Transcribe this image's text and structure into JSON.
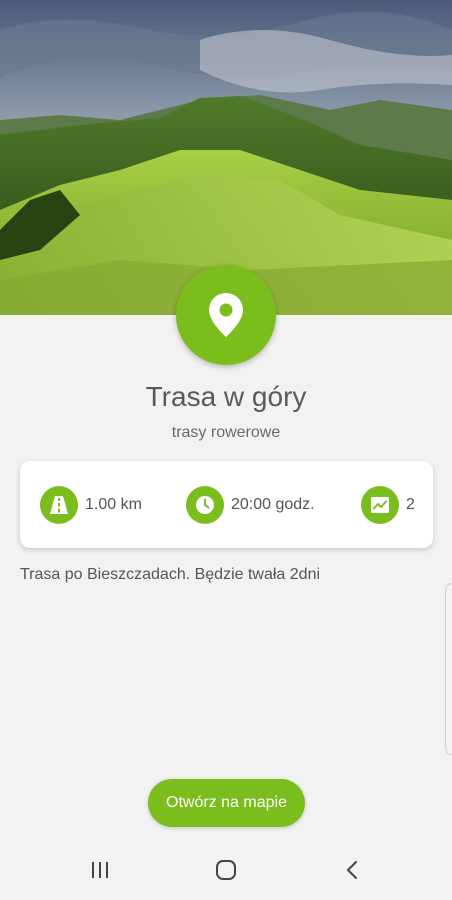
{
  "header": {
    "image_name": "mountain-landscape",
    "icon": "map-pin-icon"
  },
  "route": {
    "title": "Trasa w góry",
    "category": "trasy rowerowe",
    "description": "Trasa po Bieszczadach. Będzie twała 2dni"
  },
  "stats": {
    "distance": {
      "icon": "road-icon",
      "value": "1.00 km"
    },
    "time": {
      "icon": "clock-icon",
      "value": "20:00 godz."
    },
    "difficulty": {
      "icon": "trend-chart-icon",
      "value": "2"
    }
  },
  "actions": {
    "open_map_label": "Otwórz na mapie"
  },
  "navbar": {
    "items": [
      "recent-apps-icon",
      "home-icon",
      "back-icon"
    ]
  },
  "colors": {
    "accent": "#7cbd1e",
    "background": "#f2f2f2"
  }
}
